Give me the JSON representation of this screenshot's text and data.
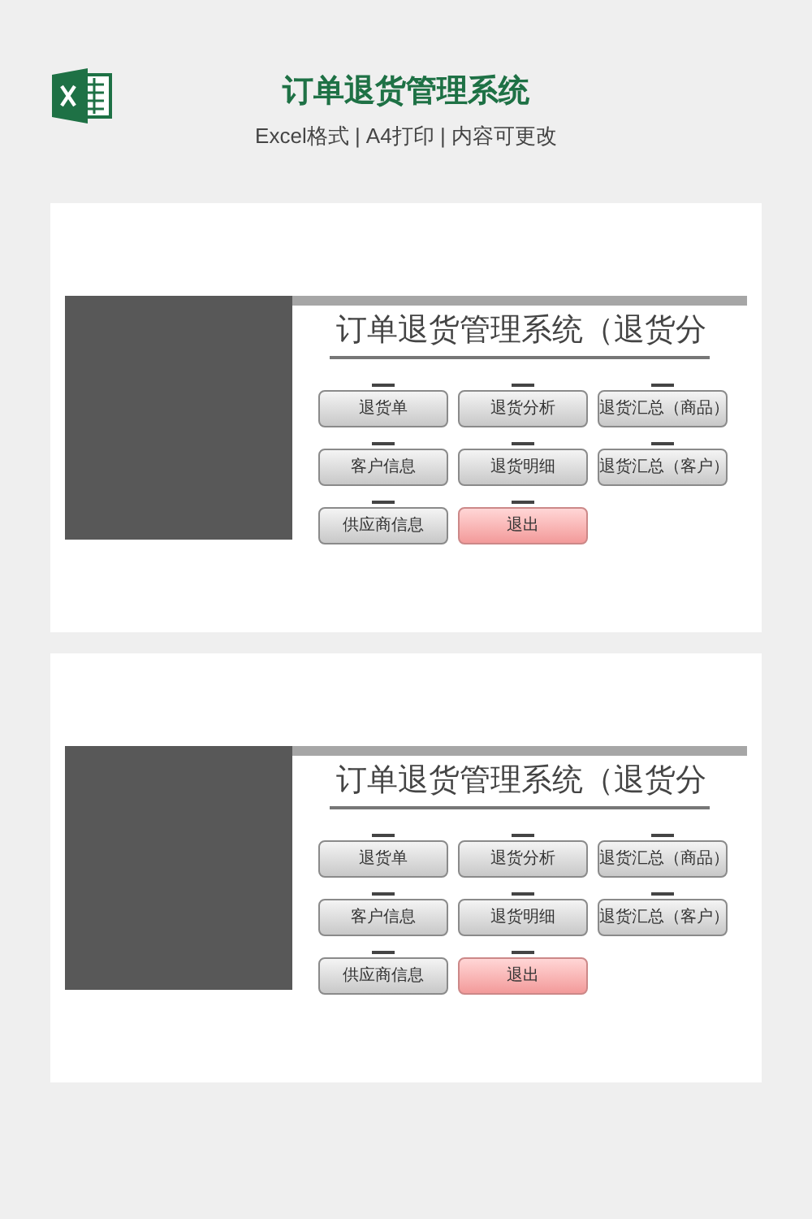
{
  "header": {
    "title": "订单退货管理系统",
    "subtitle": "Excel格式 | A4打印 | 内容可更改"
  },
  "panels": [
    {
      "heading": "订单退货管理系统（退货分",
      "buttons": [
        {
          "label": "退货单",
          "kind": "normal"
        },
        {
          "label": "退货分析",
          "kind": "normal"
        },
        {
          "label": "退货汇总（商品）",
          "kind": "normal"
        },
        {
          "label": "客户信息",
          "kind": "normal"
        },
        {
          "label": "退货明细",
          "kind": "normal"
        },
        {
          "label": "退货汇总（客户）",
          "kind": "normal"
        },
        {
          "label": "供应商信息",
          "kind": "normal"
        },
        {
          "label": "退出",
          "kind": "exit"
        }
      ]
    },
    {
      "heading": "订单退货管理系统（退货分",
      "buttons": [
        {
          "label": "退货单",
          "kind": "normal"
        },
        {
          "label": "退货分析",
          "kind": "normal"
        },
        {
          "label": "退货汇总（商品）",
          "kind": "normal"
        },
        {
          "label": "客户信息",
          "kind": "normal"
        },
        {
          "label": "退货明细",
          "kind": "normal"
        },
        {
          "label": "退货汇总（客户）",
          "kind": "normal"
        },
        {
          "label": "供应商信息",
          "kind": "normal"
        },
        {
          "label": "退出",
          "kind": "exit"
        }
      ]
    }
  ]
}
